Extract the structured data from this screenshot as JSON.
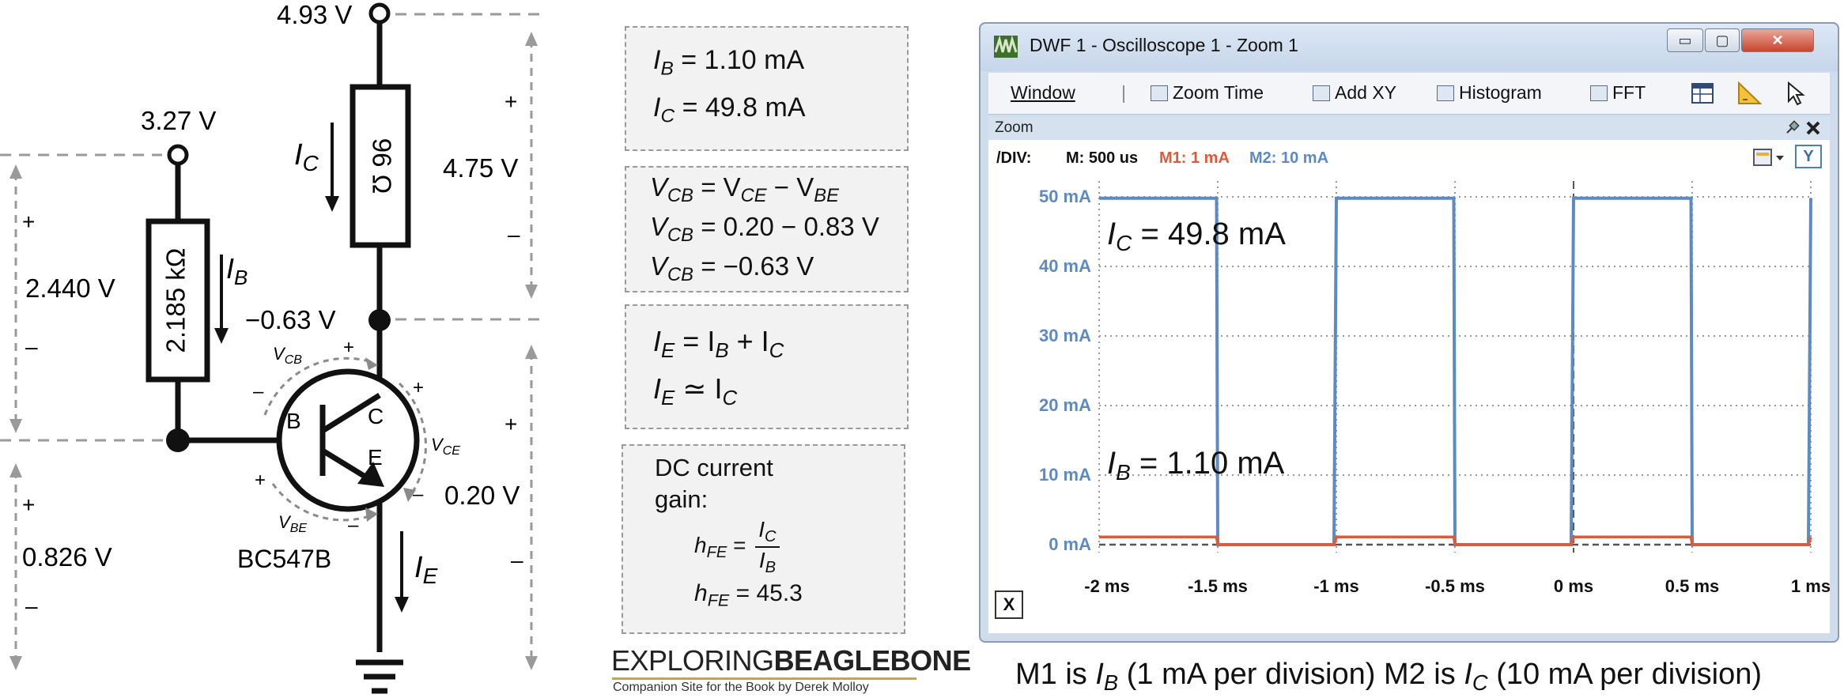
{
  "circuit": {
    "supply_collector": "4.93 V",
    "supply_base": "3.27 V",
    "resistor_collector": "96 Ω",
    "resistor_base": "2.185 kΩ",
    "ic_label_main": "I",
    "ic_label_sub": "C",
    "ib_label_main": "I",
    "ib_label_sub": "B",
    "ie_label_main": "I",
    "ie_label_sub": "E",
    "collector_voltage": "−0.63 V",
    "vcb_main": "V",
    "vcb_sub": "CB",
    "vce_main": "V",
    "vce_sub": "CE",
    "vbe_main": "V",
    "vbe_sub": "BE",
    "pin_b": "B",
    "pin_c": "C",
    "pin_e": "E",
    "transistor_part": "BC547B",
    "v_resistor_c": "4.75 V",
    "v_resistor_b": "2.440 V",
    "v_base": "0.826 V",
    "v_ce": "0.20 V",
    "plus": "+",
    "minus": "–"
  },
  "equations": {
    "box1": {
      "line1": {
        "sym": "I",
        "sub": "B",
        "rest": " = 1.10 mA"
      },
      "line2": {
        "sym": "I",
        "sub": "C",
        "rest": " = 49.8 mA"
      }
    },
    "box2": {
      "line1": "= V",
      "line1_mid_sub": "CE",
      "line1_tail": " − V",
      "line1_tail_sub": "BE",
      "line2": "= 0.20 − 0.83 V",
      "line3": "= −0.63 V",
      "sym": "V",
      "sub": "CB"
    },
    "box3": {
      "line1": " = I",
      "line1_sub": "B",
      "line1_tail": " + I",
      "line1_tail_sub": "C",
      "line2": " ≃ I",
      "line2_sub": "C",
      "sym": "I",
      "sub": "E"
    },
    "box4": {
      "title_1": "DC current",
      "title_2": "gain:",
      "hfe_sym": "h",
      "hfe_sub": "FE",
      "eq": " = ",
      "frac_num_sym": "I",
      "frac_num_sub": "C",
      "frac_den_sym": "I",
      "frac_den_sub": "B",
      "result": " = 45.3"
    }
  },
  "brand": {
    "light": "EXPLORING",
    "bold": "BEAGLEBONE",
    "tagline": "Companion Site for the Book by Derek Molloy"
  },
  "window": {
    "title": "DWF 1 - Oscilloscope 1 - Zoom 1",
    "min_label": "▭",
    "max_label": "▢",
    "close_label": "✕",
    "toolbar": {
      "window_label": "Window",
      "sep": "|",
      "zoom_time": "Zoom Time",
      "add_xy": "Add XY",
      "histogram": "Histogram",
      "fft": "FFT"
    },
    "zoom_label": "Zoom",
    "div_label": "/DIV:",
    "m_div": "M: 500 us",
    "m1_div": "M1: 1 mA",
    "m2_div": "M2: 10 mA",
    "y_button": "Y",
    "x_button": "X"
  },
  "chart_data": {
    "type": "line",
    "xlabel": "",
    "ylabel": "",
    "x_ticks": [
      "-2 ms",
      "-1.5 ms",
      "-1 ms",
      "-0.5 ms",
      "0 ms",
      "0.5 ms",
      "1 ms"
    ],
    "y_ticks": [
      "50 mA",
      "40 mA",
      "30 mA",
      "20 mA",
      "10 mA",
      "0 mA"
    ],
    "xlim": [
      -2.0,
      1.0
    ],
    "ylim": [
      0,
      50
    ],
    "grid": true,
    "annotations": [
      {
        "sym": "I",
        "sub": "C",
        "text": " = 49.8 mA"
      },
      {
        "sym": "I",
        "sub": "B",
        "text": " = 1.10 mA"
      }
    ],
    "series": [
      {
        "name": "M2",
        "color": "#5b8ac4",
        "x": [
          -2.0,
          -1.505,
          -1.5,
          -1.01,
          -1.0,
          -0.505,
          -0.5,
          -0.01,
          0.0,
          0.495,
          0.5,
          0.99,
          1.0
        ],
        "y": [
          49.8,
          49.8,
          0,
          0,
          49.8,
          49.8,
          0,
          0,
          49.8,
          49.8,
          0,
          0,
          49.8
        ]
      },
      {
        "name": "M1",
        "color": "#e05a3a",
        "x": [
          -2.0,
          -1.505,
          -1.5,
          -1.01,
          -1.0,
          -0.505,
          -0.5,
          -0.01,
          0.0,
          0.495,
          0.5,
          0.99,
          1.0
        ],
        "y": [
          1.1,
          1.1,
          0,
          0,
          1.1,
          1.1,
          0,
          0,
          1.1,
          1.1,
          0,
          0,
          1.1
        ]
      }
    ]
  },
  "caption": {
    "part1": "M1 is ",
    "sym1": "I",
    "sub1": "B",
    "part2": " (1 mA per division) M2 is ",
    "sym2": "I",
    "sub2": "C",
    "part3": " (10 mA per division)"
  }
}
